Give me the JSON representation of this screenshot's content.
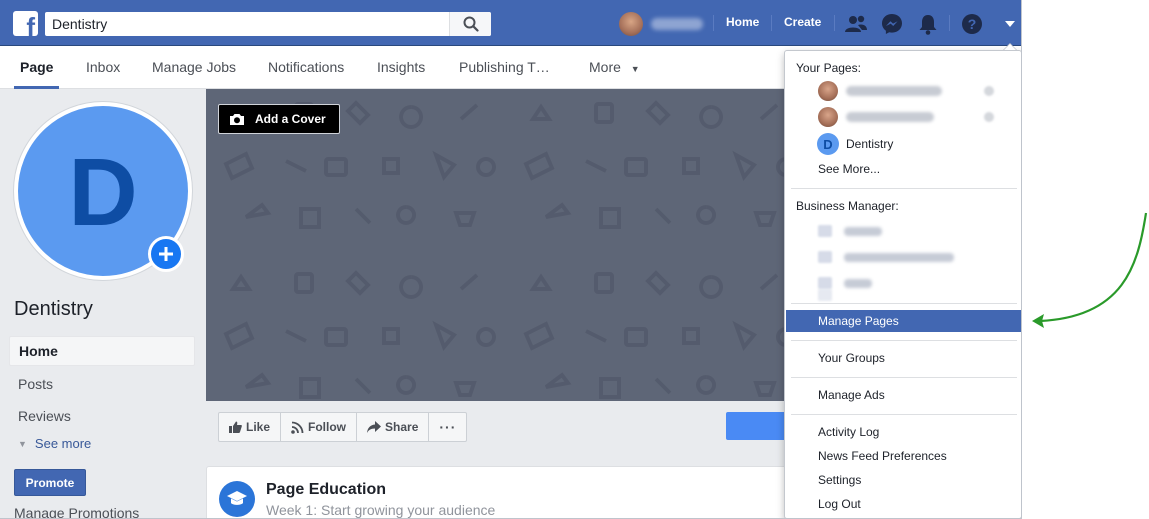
{
  "topbar": {
    "search_value": "Dentistry",
    "home_label": "Home",
    "create_label": "Create",
    "icons": [
      "facebook-logo",
      "search-icon",
      "friend-requests-icon",
      "messenger-icon",
      "notifications-icon",
      "help-icon",
      "account-menu-caret"
    ],
    "brand_color": "#4267b2"
  },
  "subnav": {
    "tabs": [
      "Page",
      "Inbox",
      "Manage Jobs",
      "Notifications",
      "Insights",
      "Publishing T…",
      "More"
    ],
    "active_tab": "Page"
  },
  "left": {
    "avatar_letter": "D",
    "page_name": "Dentistry",
    "menu": [
      "Home",
      "Posts",
      "Reviews"
    ],
    "see_more": "See more",
    "promote": "Promote",
    "manage_promotions": "Manage Promotions"
  },
  "cover": {
    "add_cover": "Add a Cover"
  },
  "actions": {
    "like": "Like",
    "follow": "Follow",
    "share": "Share",
    "more": "···"
  },
  "education": {
    "title": "Page Education",
    "subtitle": "Week 1: Start growing your audience"
  },
  "dropdown": {
    "your_pages_header": "Your Pages:",
    "dentistry": "Dentistry",
    "dentistry_avatar_letter": "D",
    "see_more": "See More...",
    "business_manager_header": "Business Manager:",
    "manage_pages": "Manage Pages",
    "your_groups": "Your Groups",
    "manage_ads": "Manage Ads",
    "activity_log": "Activity Log",
    "news_feed_preferences": "News Feed Preferences",
    "settings": "Settings",
    "log_out": "Log Out",
    "highlight_color": "#4267b2"
  },
  "annotation": {
    "arrow_color": "#2a9a2a"
  }
}
